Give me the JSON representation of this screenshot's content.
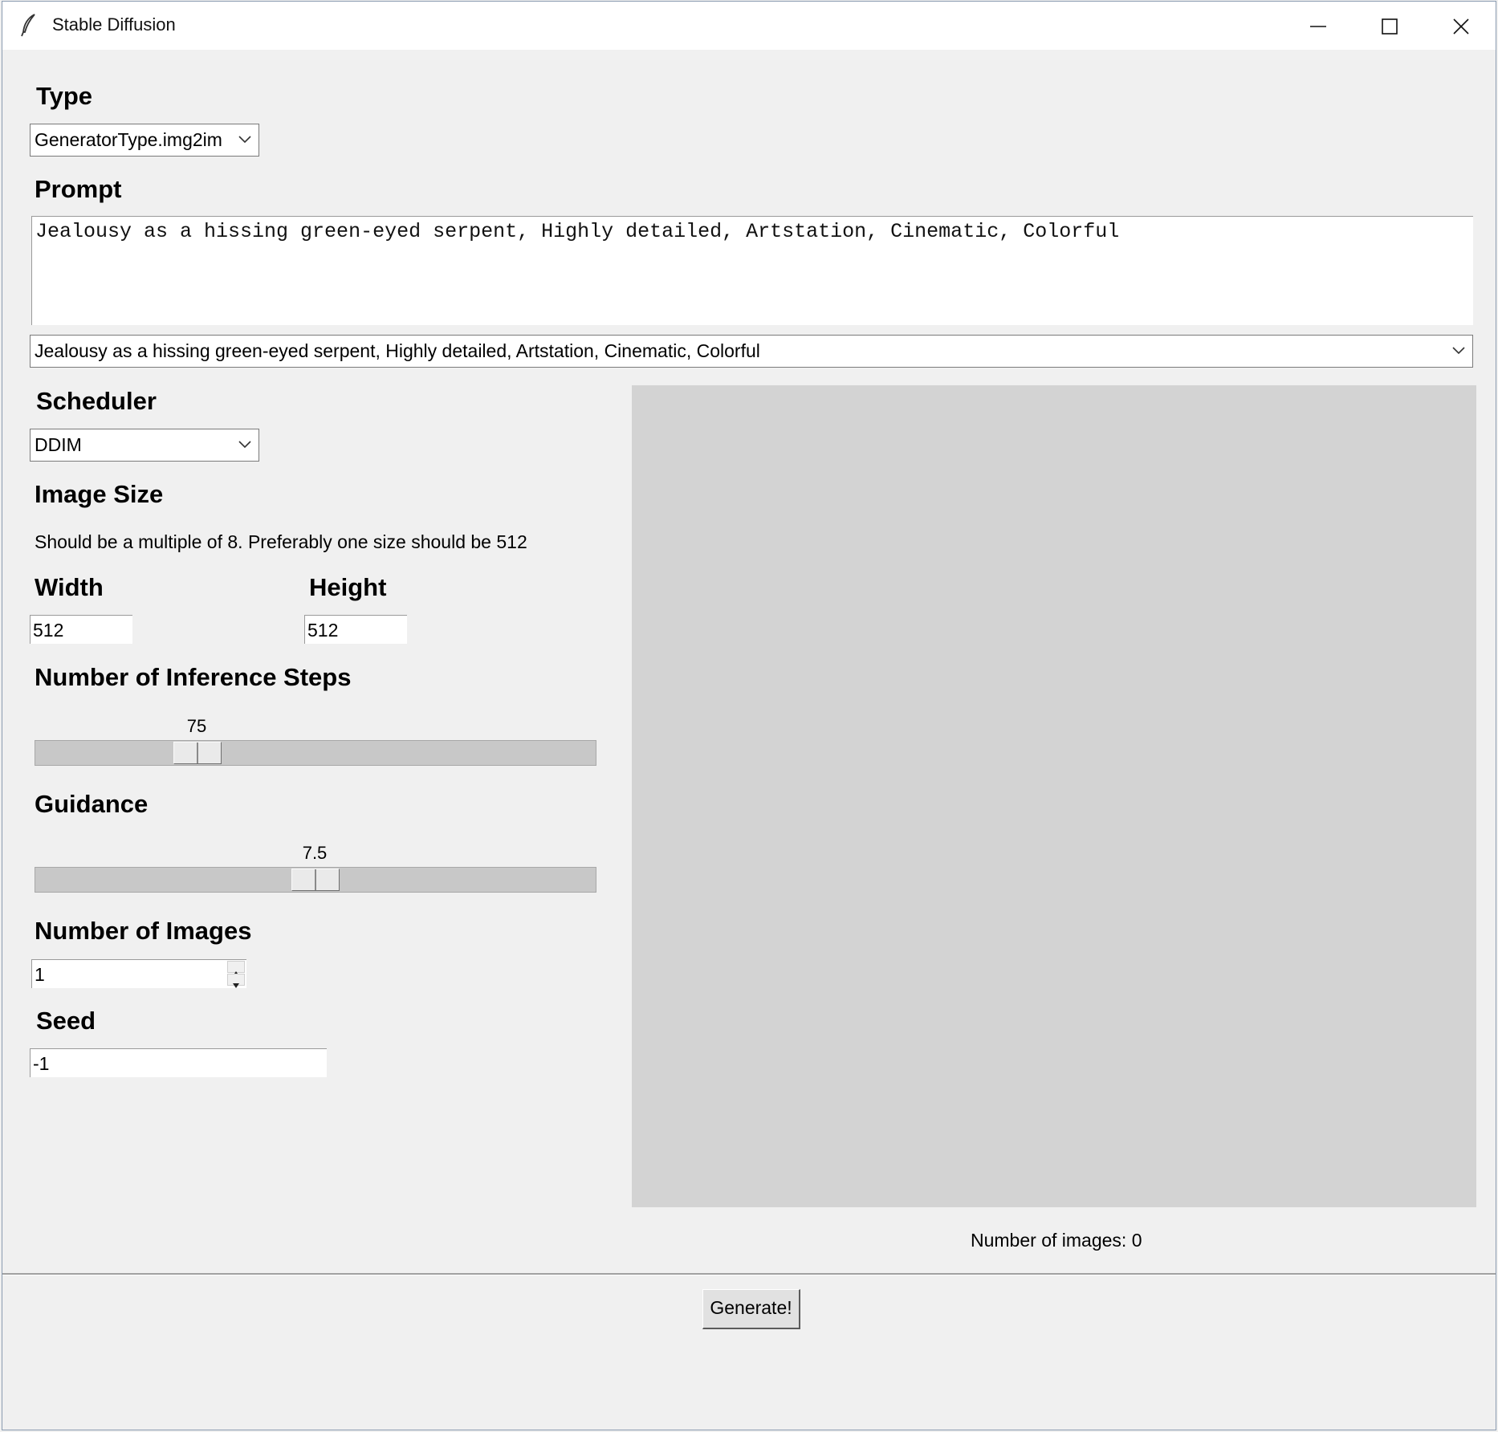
{
  "window": {
    "title": "Stable Diffusion",
    "icon": "feather-icon"
  },
  "type": {
    "label": "Type",
    "value": "GeneratorType.img2im"
  },
  "prompt": {
    "label": "Prompt",
    "text": "Jealousy as a hissing green-eyed serpent, Highly detailed, Artstation, Cinematic, Colorful",
    "history_value": "Jealousy as a hissing green-eyed serpent, Highly detailed, Artstation, Cinematic, Colorful"
  },
  "scheduler": {
    "label": "Scheduler",
    "value": "DDIM"
  },
  "image_size": {
    "label": "Image Size",
    "hint": "Should be a multiple of 8. Preferably one size should be 512",
    "width_label": "Width",
    "width_value": "512",
    "height_label": "Height",
    "height_value": "512"
  },
  "steps": {
    "label": "Number of Inference Steps",
    "value": "75",
    "fraction": 0.27
  },
  "guidance": {
    "label": "Guidance",
    "value": "7.5",
    "fraction": 0.5
  },
  "num_images": {
    "label": "Number of Images",
    "value": "1"
  },
  "seed": {
    "label": "Seed",
    "value": "-1"
  },
  "preview": {
    "count_text": "Number of images: 0"
  },
  "generate": {
    "label": "Generate!"
  }
}
